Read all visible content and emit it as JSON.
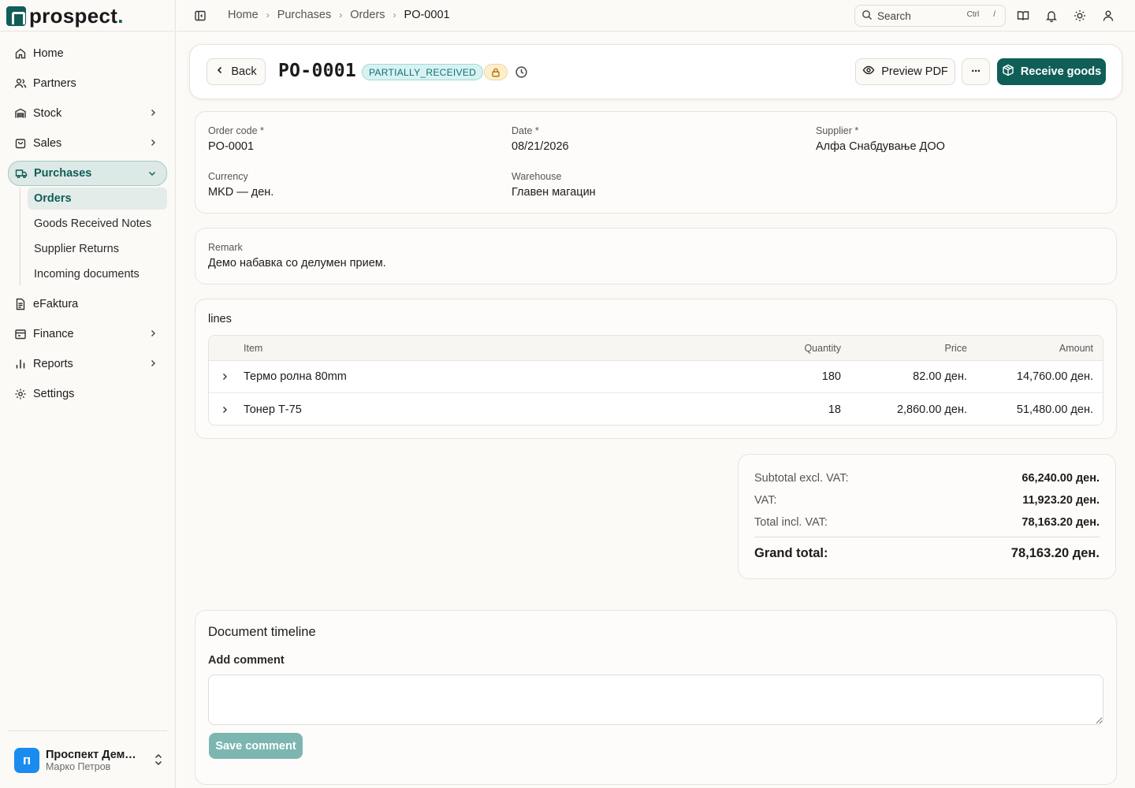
{
  "app": {
    "brand": "prospect",
    "brand_dot": "."
  },
  "sidebar": {
    "items": [
      {
        "label": "Home",
        "icon": "home-icon"
      },
      {
        "label": "Partners",
        "icon": "users-icon"
      },
      {
        "label": "Stock",
        "icon": "warehouse-icon"
      },
      {
        "label": "Sales",
        "icon": "bag-icon"
      },
      {
        "label": "Purchases",
        "icon": "truck-icon"
      },
      {
        "label": "eFaktura",
        "icon": "document-icon"
      },
      {
        "label": "Finance",
        "icon": "wallet-icon"
      },
      {
        "label": "Reports",
        "icon": "bar-chart-icon"
      },
      {
        "label": "Settings",
        "icon": "gear-icon"
      }
    ],
    "purchases_sub": [
      "Orders",
      "Goods Received Notes",
      "Supplier Returns",
      "Incoming documents"
    ],
    "user": {
      "initial": "п",
      "company": "Проспект Демо ДООЕЛ",
      "name": "Марко Петров"
    }
  },
  "topbar": {
    "breadcrumb": [
      "Home",
      "Purchases",
      "Orders",
      "PO-0001"
    ],
    "search_label": "Search",
    "shortcut_key": "Ctrl",
    "shortcut_char": "/"
  },
  "header": {
    "back_label": "Back",
    "title": "PO-0001",
    "status": "PARTIALLY_RECEIVED",
    "preview_label": "Preview PDF",
    "more_label": "···",
    "receive_label": "Receive goods"
  },
  "details": {
    "order_code": {
      "label": "Order code",
      "value": "PO-0001",
      "req": "*"
    },
    "date": {
      "label": "Date",
      "value": "08/21/2026",
      "req": "*"
    },
    "supplier": {
      "label": "Supplier",
      "value": "Алфа Снабдување ДОО",
      "req": "*"
    },
    "currency": {
      "label": "Currency",
      "value": "MKD — ден."
    },
    "warehouse": {
      "label": "Warehouse",
      "value": "Главен магацин"
    }
  },
  "remark": {
    "label": "Remark",
    "value": "Демо набавка со делумен прием."
  },
  "lines": {
    "title": "lines",
    "columns": {
      "item": "Item",
      "quantity": "Quantity",
      "price": "Price",
      "amount": "Amount"
    },
    "rows": [
      {
        "item": "Термо ролна 80mm",
        "quantity": "180",
        "price": "82.00 ден.",
        "amount": "14,760.00 ден."
      },
      {
        "item": "Тонер Т-75",
        "quantity": "18",
        "price": "2,860.00 ден.",
        "amount": "51,480.00 ден."
      }
    ]
  },
  "totals": {
    "subtotal_label": "Subtotal excl. VAT:",
    "subtotal": "66,240.00 ден.",
    "vat_label": "VAT:",
    "vat": "11,923.20 ден.",
    "total_label": "Total incl. VAT:",
    "total": "78,163.20 ден.",
    "grand_label": "Grand total:",
    "grand": "78,163.20 ден."
  },
  "timeline": {
    "title": "Document timeline",
    "comment_label": "Add comment",
    "comment_value": "",
    "save_label": "Save comment"
  },
  "colors": {
    "brand": "#0f5e58",
    "status_bg": "#d8f2f2",
    "lock_bg": "#fdefcd",
    "avatar": "#1a8cf0"
  }
}
